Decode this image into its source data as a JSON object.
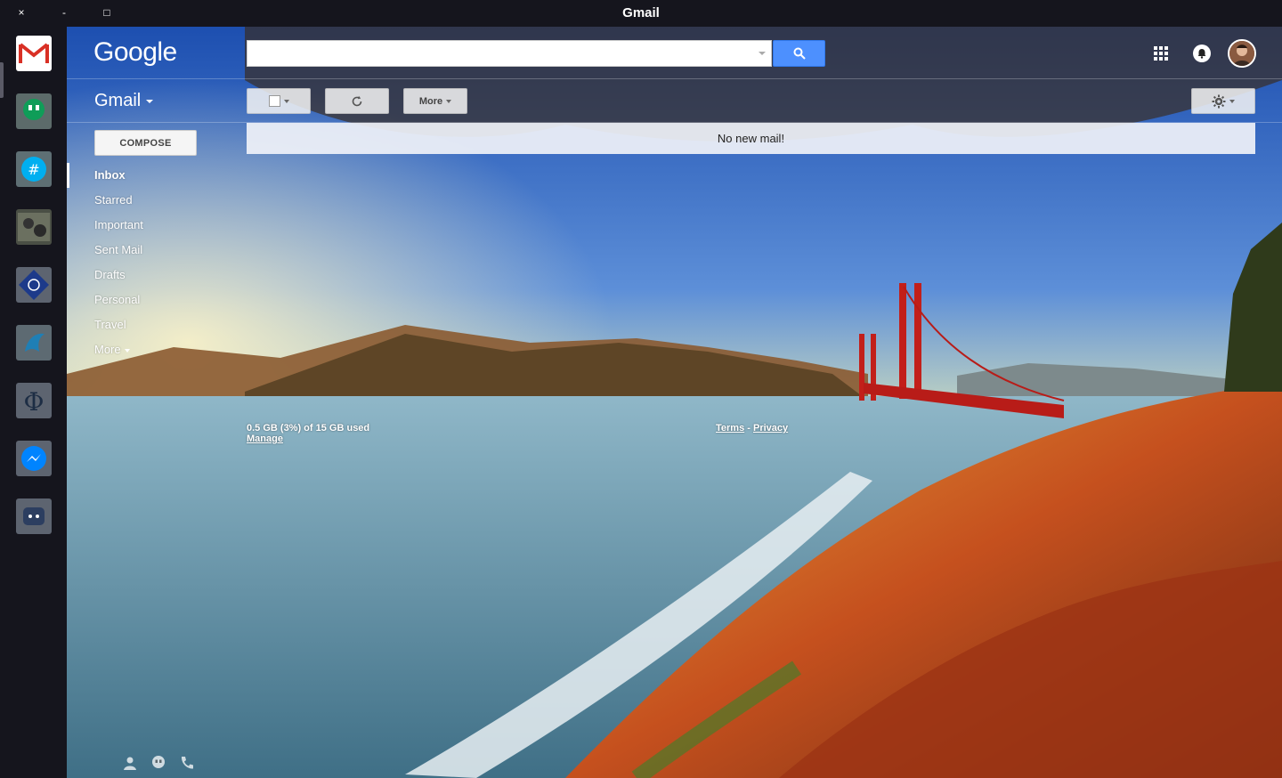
{
  "window": {
    "title": "Gmail",
    "close_glyph": "×",
    "minimize_glyph": "-",
    "maximize_glyph": "□"
  },
  "dock": {
    "apps": [
      {
        "name": "gmail-app-icon"
      },
      {
        "name": "hangouts-app-icon"
      },
      {
        "name": "groupme-app-icon"
      },
      {
        "name": "photo-app-icon"
      },
      {
        "name": "diamond-app-icon"
      },
      {
        "name": "dolphin-app-icon"
      },
      {
        "name": "phi-app-icon"
      },
      {
        "name": "messenger-app-icon"
      },
      {
        "name": "discord-app-icon"
      }
    ]
  },
  "header": {
    "logo": "Google",
    "search": {
      "placeholder": "",
      "value": ""
    }
  },
  "gmail_menu": {
    "label": "Gmail"
  },
  "toolbar": {
    "more_label": "More"
  },
  "compose": {
    "label": "COMPOSE"
  },
  "nav": {
    "items": [
      {
        "label": "Inbox"
      },
      {
        "label": "Starred"
      },
      {
        "label": "Important"
      },
      {
        "label": "Sent Mail"
      },
      {
        "label": "Drafts"
      },
      {
        "label": "Personal"
      },
      {
        "label": "Travel"
      },
      {
        "label": "More"
      }
    ]
  },
  "main": {
    "empty_message": "No new mail!"
  },
  "footer": {
    "quota": "0.5 GB (3%) of 15 GB used",
    "manage": "Manage",
    "terms": "Terms",
    "separator": " - ",
    "privacy": "Privacy"
  },
  "colors": {
    "search_button": "#4d90fe",
    "dock_bg": "#15151d"
  }
}
